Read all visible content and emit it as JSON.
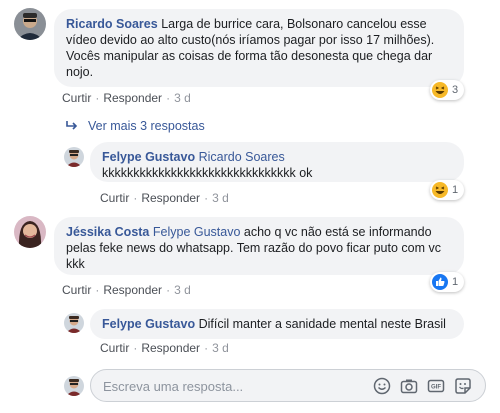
{
  "comments": [
    {
      "author": "Ricardo Soares",
      "text": "Larga de burrice cara, Bolsonaro cancelou esse vídeo devido ao alto custo(nós iríamos pagar por isso 17 milhões). Vocês manipular as coisas de forma tão desonesta que chega dar nojo.",
      "like_label": "Curtir",
      "reply_label": "Responder",
      "time": "3 d",
      "reaction_icon": "haha-icon",
      "reaction_count": "3"
    },
    {
      "author": "Jéssika Costa",
      "mention": "Felype Gustavo",
      "text": "acho q vc não está se informando pelas feke news do whatsapp. Tem razão do povo ficar puto com vc kkk",
      "like_label": "Curtir",
      "reply_label": "Responder",
      "time": "3 d",
      "reaction_icon": "like-icon",
      "reaction_count": "1"
    }
  ],
  "more_replies_label": "Ver mais 3 respostas",
  "replies": [
    {
      "author": "Felype Gustavo",
      "mention": "Ricardo Soares",
      "text": "kkkkkkkkkkkkkkkkkkkkkkkkkkkkkkk ok",
      "like_label": "Curtir",
      "reply_label": "Responder",
      "time": "3 d",
      "reaction_icon": "haha-icon",
      "reaction_count": "1"
    },
    {
      "author": "Felype Gustavo",
      "mention": "",
      "text": "Difícil manter a sanidade mental neste Brasil",
      "like_label": "Curtir",
      "reply_label": "Responder",
      "time": "3 d"
    }
  ],
  "composer": {
    "placeholder": "Escreva uma resposta...",
    "tools": [
      "emoji-icon",
      "camera-icon",
      "gif-icon",
      "sticker-icon"
    ]
  },
  "colors": {
    "link": "#385898",
    "bubble": "#f2f3f5",
    "meta": "#90949c",
    "like_blue": "#1877f2",
    "haha_yellow": "#f7b928"
  }
}
